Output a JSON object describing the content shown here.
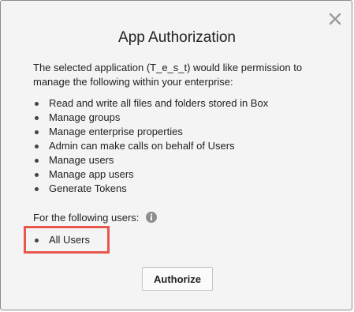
{
  "dialog": {
    "title": "App Authorization",
    "intro": "The selected application (T_e_s_t) would like permission to manage the following within your enterprise:",
    "permissions": [
      "Read and write all files and folders stored in Box",
      "Manage groups",
      "Manage enterprise properties",
      "Admin can make calls on behalf of Users",
      "Manage users",
      "Manage app users",
      "Generate Tokens"
    ],
    "users_label": "For the following users:",
    "users": [
      "All Users"
    ],
    "authorize_label": "Authorize",
    "close_icon": "close-icon",
    "info_icon": "info-icon",
    "highlight_color": "#e8574e"
  }
}
